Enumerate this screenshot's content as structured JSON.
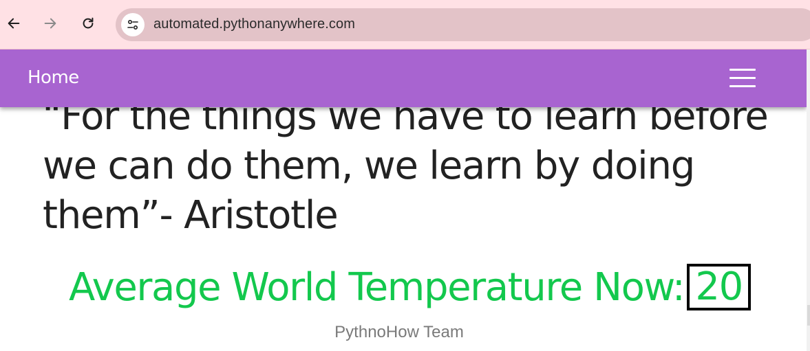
{
  "browser": {
    "url": "automated.pythonanywhere.com",
    "icons": {
      "back": "arrow-left-icon",
      "forward": "arrow-right-icon",
      "reload": "reload-icon",
      "site_info": "tune-icon"
    }
  },
  "navbar": {
    "home_label": "Home",
    "menu_icon": "hamburger-menu-icon",
    "color": "#a864d0"
  },
  "main": {
    "quote": "“For the things we have to learn before we can do them, we learn by doing them”- Aristotle",
    "temperature_label": "Average World Temperature Now:",
    "temperature_value": "20",
    "temperature_color": "#13c84d",
    "footer": "PythnoHow Team"
  }
}
